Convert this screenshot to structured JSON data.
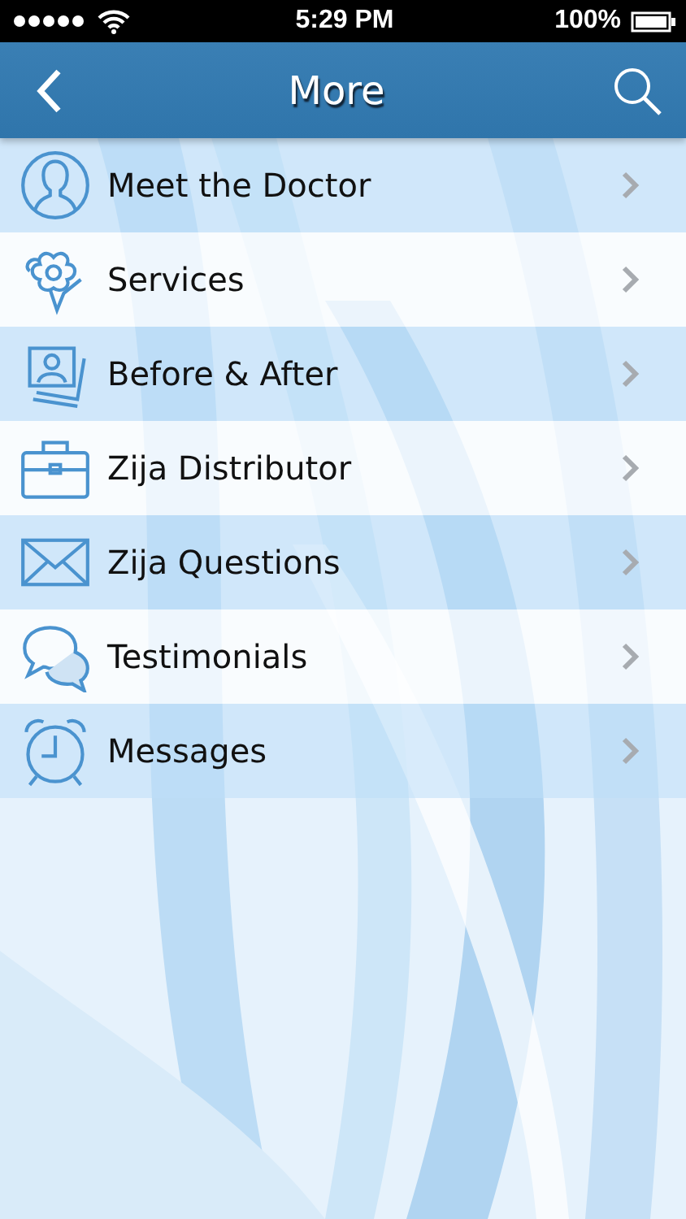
{
  "status_bar": {
    "time": "5:29 PM",
    "battery": "100%"
  },
  "nav_bar": {
    "title": "More"
  },
  "menu": [
    {
      "label": "Meet the Doctor",
      "kind": "person"
    },
    {
      "label": "Services",
      "kind": "flowers"
    },
    {
      "label": "Before & After",
      "kind": "photos"
    },
    {
      "label": "Zija Distributor",
      "kind": "briefcase"
    },
    {
      "label": "Zija Questions",
      "kind": "envelope"
    },
    {
      "label": "Testimonials",
      "kind": "chat"
    },
    {
      "label": "Messages",
      "kind": "alarm"
    }
  ]
}
